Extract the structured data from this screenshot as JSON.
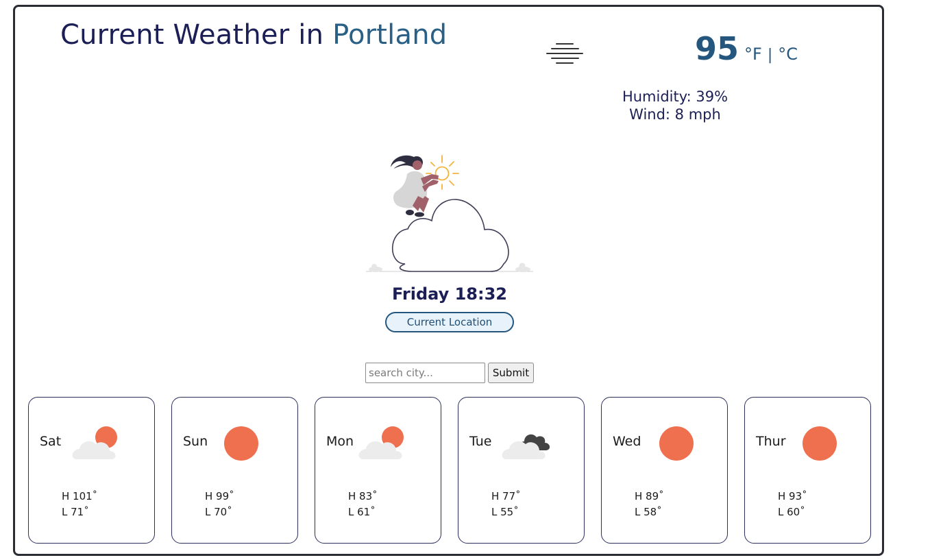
{
  "header": {
    "title_prefix": "Current Weather in",
    "city": "Portland"
  },
  "current": {
    "icon": "haze-icon",
    "temperature": "95",
    "unit_f": "°F",
    "unit_sep": "|",
    "unit_c": "°C",
    "humidity": "Humidity: 39%",
    "wind": "Wind: 8 mph",
    "datetime": "Friday 18:32",
    "location_button": "Current Location"
  },
  "search": {
    "placeholder": "search city...",
    "submit_label": "Submit"
  },
  "forecast": [
    {
      "day": "Sat",
      "icon": "partly-cloudy-icon",
      "high": "H 101˚",
      "low": "L 71˚"
    },
    {
      "day": "Sun",
      "icon": "sun-icon",
      "high": "H 99˚",
      "low": "L 70˚"
    },
    {
      "day": "Mon",
      "icon": "partly-cloudy-icon",
      "high": "H 83˚",
      "low": "L 61˚"
    },
    {
      "day": "Tue",
      "icon": "cloudy-icon",
      "high": "H 77˚",
      "low": "L 55˚"
    },
    {
      "day": "Wed",
      "icon": "sun-icon",
      "high": "H 89˚",
      "low": "L 58˚"
    },
    {
      "day": "Thur",
      "icon": "sun-icon",
      "high": "H 93˚",
      "low": "L 60˚"
    }
  ],
  "colors": {
    "title": "#1b1f55",
    "city": "#2a5f86",
    "temperature": "#24567e",
    "sun": "#ee704f",
    "cloud_light": "#ececec",
    "cloud_dark": "#444444",
    "card_border": "#2b2f5e"
  }
}
